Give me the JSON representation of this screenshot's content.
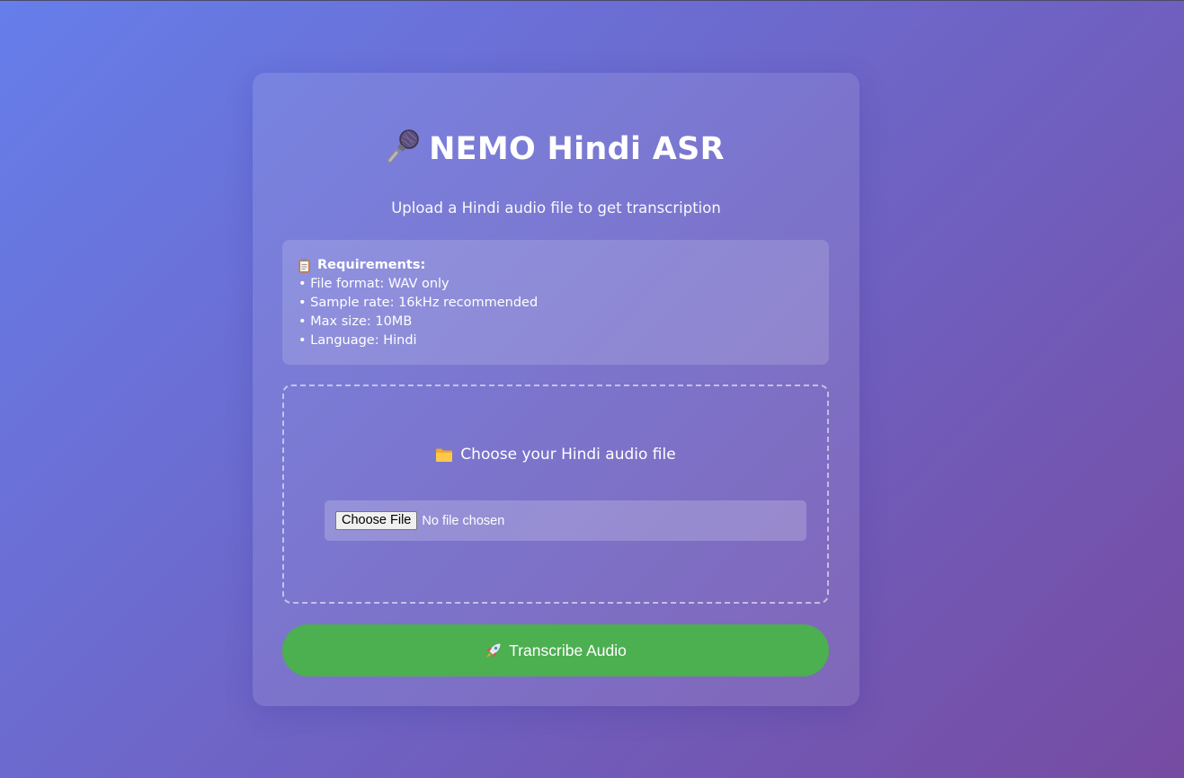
{
  "header": {
    "title": "NEMO Hindi ASR",
    "title_icon": "microphone-icon",
    "subtitle": "Upload a Hindi audio file to get transcription"
  },
  "requirements": {
    "icon": "clipboard-icon",
    "heading": "Requirements:",
    "items": [
      "• File format: WAV only",
      "• Sample rate: 16kHz recommended",
      "• Max size: 10MB",
      "• Language: Hindi"
    ]
  },
  "upload": {
    "icon": "folder-icon",
    "label": "Choose your Hindi audio file",
    "choose_button": "Choose File",
    "status": "No file chosen"
  },
  "action": {
    "icon": "rocket-icon",
    "label": "Transcribe Audio"
  },
  "colors": {
    "gradient_start": "#667eea",
    "gradient_end": "#764ba2",
    "action_button": "#4caf50"
  }
}
